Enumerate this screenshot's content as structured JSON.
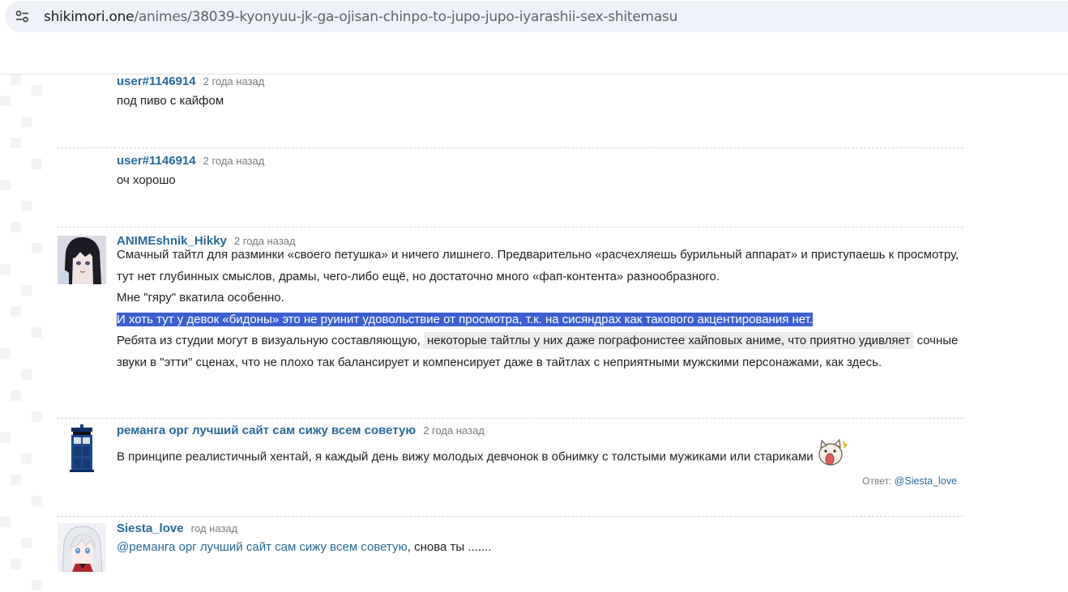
{
  "browser": {
    "url_host": "shikimori.one",
    "url_path": "/animes/38039-kyonyuu-jk-ga-ojisan-chinpo-to-jupo-jupo-iyarashii-sex-shitemasu",
    "site_info_icon": "tune-icon"
  },
  "comments": [
    {
      "author": "user#1146914",
      "time": "2 года назад",
      "text": "под пиво с кайфом"
    },
    {
      "author": "user#1146914",
      "time": "2 года назад",
      "text": "оч хорошо"
    },
    {
      "author": "ANIMEshnik_Hikky",
      "time": "2 года назад",
      "avatar_icon": "anime-girl-avatar",
      "line1": "Смачный тайтл для разминки «своего петушка» и ничего лишнего. Предварительно «расчехляешь бурильный аппарат» и приступаешь к просмотру, тут нет глубинных смыслов, драмы, чего-либо ещё, но достаточно много «фап-контента» разнообразного.",
      "line2": "Мне \"гяру\" вкатила особенно.",
      "selected": "И хоть тут у девок «бидоны» это не руинит удовольствие от просмотра, т.к. на сисяндрах как такового акцентирования нет.",
      "line4_a": "Ребята из студии могут в визуальную составляющую,",
      "highlight": "некоторые тайтлы у них даже пографонистее хайповых аниме, что приятно удивляет",
      "line4_b": "сочные звуки в \"этти\" сценах, что не плохо так балансирует и компенсирует даже в тайтлах с неприятными мужскими персонажами, как здесь."
    },
    {
      "author": "реманга орг лучший сайт сам сижу всем советую",
      "time": "2 года назад",
      "avatar_icon": "tardis-avatar",
      "text": "В принципе реалистичный хентай, я каждый день вижу молодых девчонок в обнимку с толстыми мужиками или стариками",
      "sticker_icon": "screaming-cat-sticker",
      "reply_label": "Ответ:",
      "reply_to": "@Siesta_love"
    },
    {
      "author": "Siesta_love",
      "time": "год назад",
      "avatar_icon": "white-hair-girl-avatar",
      "mention": "@реманга орг лучший сайт сам сижу всем советую",
      "text": ", снова ты ......."
    }
  ]
}
